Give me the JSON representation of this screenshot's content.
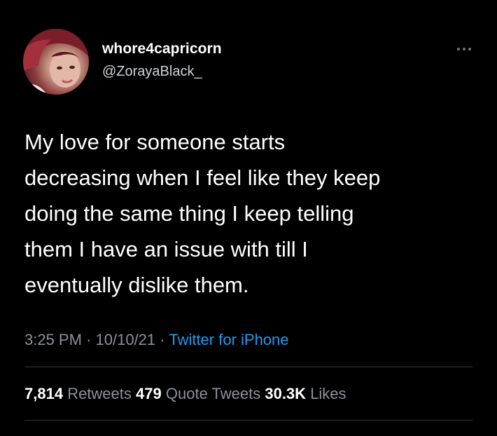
{
  "tweet": {
    "display_name": "whore4capricorn",
    "handle": "@ZorayaBlack_",
    "text": "My love for someone starts\ndecreasing when I feel like they keep\ndoing the same thing I keep telling\nthem I have an issue with till I\neventually dislike them.",
    "time": "3:25 PM",
    "date": "10/10/21",
    "separator": "·",
    "source": "Twitter for iPhone",
    "more_icon": "more-horizontal-icon"
  },
  "stats": {
    "retweets": {
      "count": "7,814",
      "label": "Retweets"
    },
    "quote_tweets": {
      "count": "479",
      "label": "Quote Tweets"
    },
    "likes": {
      "count": "30.3K",
      "label": "Likes"
    }
  },
  "colors": {
    "background": "#000000",
    "text": "#ffffff",
    "secondary": "#8b9298",
    "link": "#1d9bf0",
    "divider": "#2f3336"
  }
}
